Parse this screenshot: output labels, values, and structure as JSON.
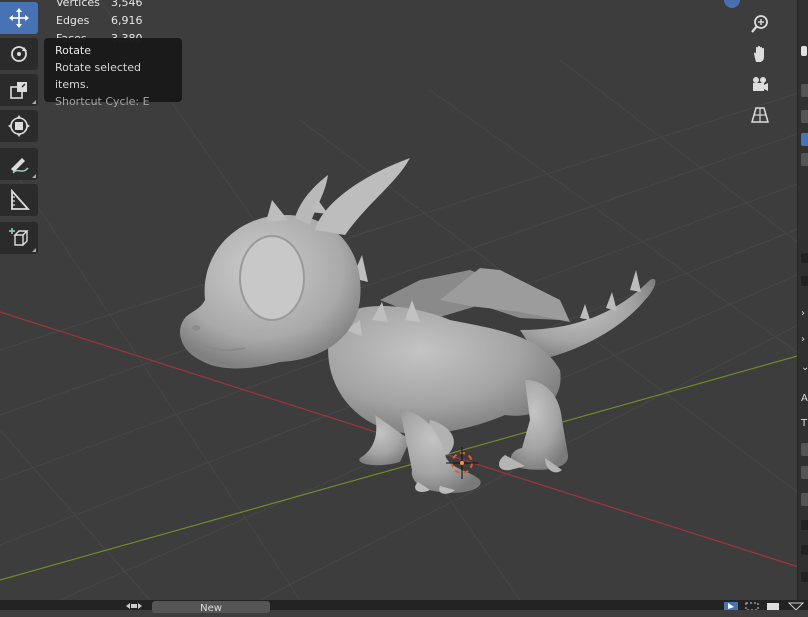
{
  "stats": {
    "rows": [
      {
        "label": "Vertices",
        "value": "3,546"
      },
      {
        "label": "Edges",
        "value": "6,916"
      },
      {
        "label": "Faces",
        "value": "3,380"
      }
    ]
  },
  "tooltip": {
    "title": "Rotate",
    "description": "Rotate selected items.",
    "shortcut": "Shortcut Cycle: E"
  },
  "toolbar": {
    "tools": [
      {
        "name": "move-tool",
        "icon": "move-arrows-icon",
        "active": true
      },
      {
        "name": "rotate-tool",
        "icon": "rotate-icon",
        "active": false
      },
      {
        "name": "scale-tool",
        "icon": "scale-icon",
        "active": false
      },
      {
        "name": "transform-tool",
        "icon": "transform-icon",
        "active": false
      },
      {
        "name": "annotate-tool",
        "icon": "annotate-pencil-icon",
        "active": false
      },
      {
        "name": "measure-tool",
        "icon": "measure-ruler-icon",
        "active": false
      },
      {
        "name": "add-cube-tool",
        "icon": "add-cube-icon",
        "active": false
      }
    ]
  },
  "navigation": {
    "buttons": [
      "zoom-icon",
      "hand-pan-icon",
      "camera-icon",
      "perspective-grid-icon"
    ]
  },
  "right_panel": {
    "letters": [
      "A",
      "T"
    ]
  },
  "bottom_bar": {
    "new_label": "New"
  },
  "colors": {
    "viewport_bg": "#3d3d3d",
    "active_tool": "#4772b3",
    "x_axis": "#a0333f",
    "y_axis": "#6e8b2a",
    "model": "#a8a8a8"
  }
}
